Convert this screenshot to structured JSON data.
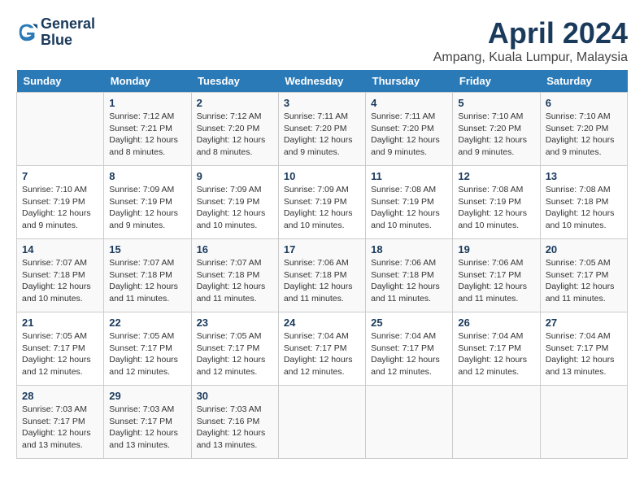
{
  "header": {
    "logo_line1": "General",
    "logo_line2": "Blue",
    "title": "April 2024",
    "location": "Ampang, Kuala Lumpur, Malaysia"
  },
  "days_of_week": [
    "Sunday",
    "Monday",
    "Tuesday",
    "Wednesday",
    "Thursday",
    "Friday",
    "Saturday"
  ],
  "weeks": [
    [
      {
        "day": "",
        "text": ""
      },
      {
        "day": "1",
        "text": "Sunrise: 7:12 AM\nSunset: 7:21 PM\nDaylight: 12 hours\nand 8 minutes."
      },
      {
        "day": "2",
        "text": "Sunrise: 7:12 AM\nSunset: 7:20 PM\nDaylight: 12 hours\nand 8 minutes."
      },
      {
        "day": "3",
        "text": "Sunrise: 7:11 AM\nSunset: 7:20 PM\nDaylight: 12 hours\nand 9 minutes."
      },
      {
        "day": "4",
        "text": "Sunrise: 7:11 AM\nSunset: 7:20 PM\nDaylight: 12 hours\nand 9 minutes."
      },
      {
        "day": "5",
        "text": "Sunrise: 7:10 AM\nSunset: 7:20 PM\nDaylight: 12 hours\nand 9 minutes."
      },
      {
        "day": "6",
        "text": "Sunrise: 7:10 AM\nSunset: 7:20 PM\nDaylight: 12 hours\nand 9 minutes."
      }
    ],
    [
      {
        "day": "7",
        "text": "Sunrise: 7:10 AM\nSunset: 7:19 PM\nDaylight: 12 hours\nand 9 minutes."
      },
      {
        "day": "8",
        "text": "Sunrise: 7:09 AM\nSunset: 7:19 PM\nDaylight: 12 hours\nand 9 minutes."
      },
      {
        "day": "9",
        "text": "Sunrise: 7:09 AM\nSunset: 7:19 PM\nDaylight: 12 hours\nand 10 minutes."
      },
      {
        "day": "10",
        "text": "Sunrise: 7:09 AM\nSunset: 7:19 PM\nDaylight: 12 hours\nand 10 minutes."
      },
      {
        "day": "11",
        "text": "Sunrise: 7:08 AM\nSunset: 7:19 PM\nDaylight: 12 hours\nand 10 minutes."
      },
      {
        "day": "12",
        "text": "Sunrise: 7:08 AM\nSunset: 7:19 PM\nDaylight: 12 hours\nand 10 minutes."
      },
      {
        "day": "13",
        "text": "Sunrise: 7:08 AM\nSunset: 7:18 PM\nDaylight: 12 hours\nand 10 minutes."
      }
    ],
    [
      {
        "day": "14",
        "text": "Sunrise: 7:07 AM\nSunset: 7:18 PM\nDaylight: 12 hours\nand 10 minutes."
      },
      {
        "day": "15",
        "text": "Sunrise: 7:07 AM\nSunset: 7:18 PM\nDaylight: 12 hours\nand 11 minutes."
      },
      {
        "day": "16",
        "text": "Sunrise: 7:07 AM\nSunset: 7:18 PM\nDaylight: 12 hours\nand 11 minutes."
      },
      {
        "day": "17",
        "text": "Sunrise: 7:06 AM\nSunset: 7:18 PM\nDaylight: 12 hours\nand 11 minutes."
      },
      {
        "day": "18",
        "text": "Sunrise: 7:06 AM\nSunset: 7:18 PM\nDaylight: 12 hours\nand 11 minutes."
      },
      {
        "day": "19",
        "text": "Sunrise: 7:06 AM\nSunset: 7:17 PM\nDaylight: 12 hours\nand 11 minutes."
      },
      {
        "day": "20",
        "text": "Sunrise: 7:05 AM\nSunset: 7:17 PM\nDaylight: 12 hours\nand 11 minutes."
      }
    ],
    [
      {
        "day": "21",
        "text": "Sunrise: 7:05 AM\nSunset: 7:17 PM\nDaylight: 12 hours\nand 12 minutes."
      },
      {
        "day": "22",
        "text": "Sunrise: 7:05 AM\nSunset: 7:17 PM\nDaylight: 12 hours\nand 12 minutes."
      },
      {
        "day": "23",
        "text": "Sunrise: 7:05 AM\nSunset: 7:17 PM\nDaylight: 12 hours\nand 12 minutes."
      },
      {
        "day": "24",
        "text": "Sunrise: 7:04 AM\nSunset: 7:17 PM\nDaylight: 12 hours\nand 12 minutes."
      },
      {
        "day": "25",
        "text": "Sunrise: 7:04 AM\nSunset: 7:17 PM\nDaylight: 12 hours\nand 12 minutes."
      },
      {
        "day": "26",
        "text": "Sunrise: 7:04 AM\nSunset: 7:17 PM\nDaylight: 12 hours\nand 12 minutes."
      },
      {
        "day": "27",
        "text": "Sunrise: 7:04 AM\nSunset: 7:17 PM\nDaylight: 12 hours\nand 13 minutes."
      }
    ],
    [
      {
        "day": "28",
        "text": "Sunrise: 7:03 AM\nSunset: 7:17 PM\nDaylight: 12 hours\nand 13 minutes."
      },
      {
        "day": "29",
        "text": "Sunrise: 7:03 AM\nSunset: 7:17 PM\nDaylight: 12 hours\nand 13 minutes."
      },
      {
        "day": "30",
        "text": "Sunrise: 7:03 AM\nSunset: 7:16 PM\nDaylight: 12 hours\nand 13 minutes."
      },
      {
        "day": "",
        "text": ""
      },
      {
        "day": "",
        "text": ""
      },
      {
        "day": "",
        "text": ""
      },
      {
        "day": "",
        "text": ""
      }
    ]
  ]
}
